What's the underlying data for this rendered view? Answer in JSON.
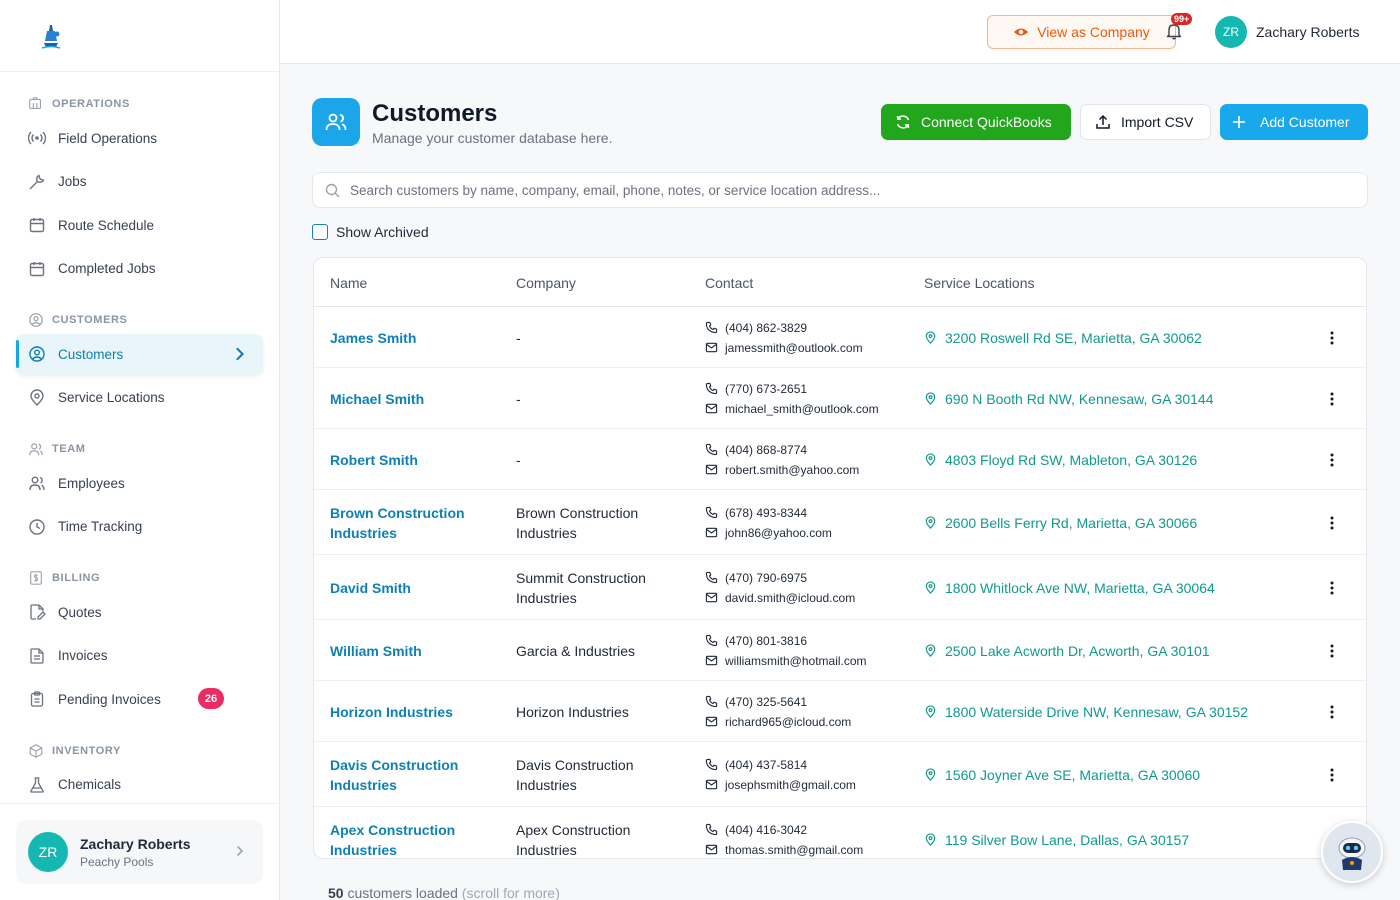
{
  "topbar": {
    "view_as_label": "View as Company",
    "notification_badge": "99+",
    "user_initials": "ZR",
    "user_name": "Zachary Roberts"
  },
  "sidebar": {
    "sections": [
      {
        "title": "OPERATIONS",
        "icon": "building-icon",
        "items": [
          {
            "label": "Field Operations",
            "icon": "broadcast-icon"
          },
          {
            "label": "Jobs",
            "icon": "wrench-icon"
          },
          {
            "label": "Route Schedule",
            "icon": "calendar-icon"
          },
          {
            "label": "Completed Jobs",
            "icon": "calendar-icon"
          }
        ]
      },
      {
        "title": "CUSTOMERS",
        "icon": "user-circle-icon",
        "items": [
          {
            "label": "Customers",
            "icon": "user-circle-icon",
            "active": true
          },
          {
            "label": "Service Locations",
            "icon": "map-pin-icon"
          }
        ]
      },
      {
        "title": "TEAM",
        "icon": "users-icon",
        "items": [
          {
            "label": "Employees",
            "icon": "users-icon"
          },
          {
            "label": "Time Tracking",
            "icon": "clock-icon"
          }
        ]
      },
      {
        "title": "BILLING",
        "icon": "dollar-icon",
        "items": [
          {
            "label": "Quotes",
            "icon": "file-edit-icon"
          },
          {
            "label": "Invoices",
            "icon": "file-text-icon"
          },
          {
            "label": "Pending Invoices",
            "icon": "clipboard-icon",
            "badge": "26"
          }
        ]
      },
      {
        "title": "INVENTORY",
        "icon": "box-icon",
        "items": [
          {
            "label": "Chemicals",
            "icon": "flask-icon"
          }
        ]
      }
    ],
    "user": {
      "initials": "ZR",
      "name": "Zachary Roberts",
      "org": "Peachy Pools"
    }
  },
  "header": {
    "title": "Customers",
    "subtitle": "Manage your customer database here.",
    "connect_label": "Connect QuickBooks",
    "import_label": "Import CSV",
    "add_label": "Add Customer"
  },
  "search": {
    "placeholder": "Search customers by name, company, email, phone, notes, or service location address..."
  },
  "filters": {
    "show_archived_label": "Show Archived"
  },
  "table": {
    "columns": [
      "Name",
      "Company",
      "Contact",
      "Service Locations"
    ],
    "rows": [
      {
        "name": [
          "James Smith"
        ],
        "company": [
          "-"
        ],
        "phone": "(404) 862-3829",
        "email": "jamessmith@outlook.com",
        "location": "3200 Roswell Rd SE, Marietta, GA 30062"
      },
      {
        "name": [
          "Michael Smith"
        ],
        "company": [
          "-"
        ],
        "phone": "(770) 673-2651",
        "email": "michael_smith@outlook.com",
        "location": "690 N Booth Rd NW, Kennesaw, GA 30144"
      },
      {
        "name": [
          "Robert Smith"
        ],
        "company": [
          "-"
        ],
        "phone": "(404) 868-8774",
        "email": "robert.smith@yahoo.com",
        "location": "4803 Floyd Rd SW, Mableton, GA 30126"
      },
      {
        "name": [
          "Brown Construction",
          "Industries"
        ],
        "company": [
          "Brown Construction",
          "Industries"
        ],
        "phone": "(678) 493-8344",
        "email": "john86@yahoo.com",
        "location": "2600 Bells Ferry Rd, Marietta, GA 30066"
      },
      {
        "name": [
          "David Smith"
        ],
        "company": [
          "Summit Construction",
          "Industries"
        ],
        "phone": "(470) 790-6975",
        "email": "david.smith@icloud.com",
        "location": "1800 Whitlock Ave NW, Marietta, GA 30064"
      },
      {
        "name": [
          "William Smith"
        ],
        "company": [
          "Garcia & Industries"
        ],
        "phone": "(470) 801-3816",
        "email": "williamsmith@hotmail.com",
        "location": "2500 Lake Acworth Dr, Acworth, GA 30101"
      },
      {
        "name": [
          "Horizon Industries"
        ],
        "company": [
          "Horizon Industries"
        ],
        "phone": "(470) 325-5641",
        "email": "richard965@icloud.com",
        "location": "1800 Waterside Drive NW, Kennesaw, GA 30152"
      },
      {
        "name": [
          "Davis Construction",
          "Industries"
        ],
        "company": [
          "Davis Construction",
          "Industries"
        ],
        "phone": "(404) 437-5814",
        "email": "josephsmith@gmail.com",
        "location": "1560 Joyner Ave SE, Marietta, GA 30060"
      },
      {
        "name": [
          "Apex Construction",
          "Industries"
        ],
        "company": [
          "Apex Construction",
          "Industries"
        ],
        "phone": "(404) 416-3042",
        "email": "thomas.smith@gmail.com",
        "location": "119 Silver Bow Lane, Dallas, GA 30157"
      }
    ]
  },
  "footer": {
    "count": "50",
    "text": "customers loaded",
    "hint": "(scroll for more)"
  },
  "colors": {
    "accent": "#18a9ec",
    "quickbooks": "#22a61c",
    "link": "#0e81b4",
    "location": "#109a8e",
    "badge": "#ec2a63"
  }
}
